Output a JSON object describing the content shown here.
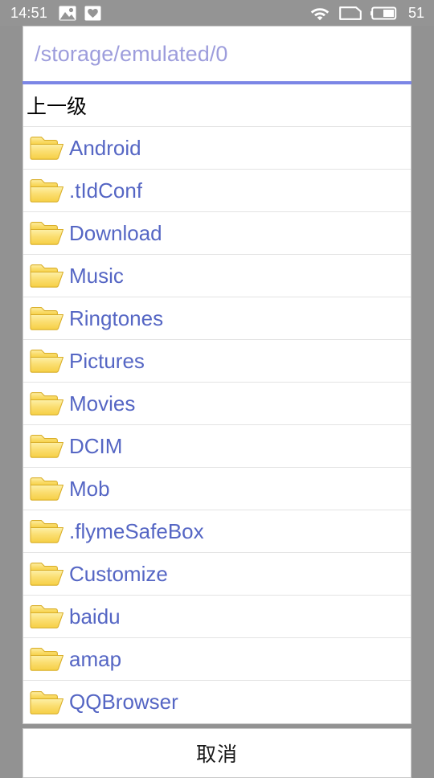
{
  "status_bar": {
    "time": "14:51",
    "battery_level": "51",
    "left_icons": [
      "image-notification-icon",
      "heart-shield-notification-icon"
    ],
    "right_icons": [
      "wifi-icon",
      "sim-card-icon",
      "battery-icon"
    ],
    "background_color": "#949494",
    "foreground_color": "#ffffff"
  },
  "dialog": {
    "path_field": {
      "value": "/storage/emulated/0",
      "placeholder": "/storage/emulated/0",
      "text_color": "#9d9ddc",
      "underline_color": "#7b86e6"
    },
    "parent_entry": {
      "label": "上一级",
      "text_color": "#000000"
    },
    "folder_text_color": "#5566c4",
    "entries": [
      {
        "name": "Android",
        "icon": "folder-icon"
      },
      {
        "name": ".tIdConf",
        "icon": "folder-icon"
      },
      {
        "name": "Download",
        "icon": "folder-icon"
      },
      {
        "name": "Music",
        "icon": "folder-icon"
      },
      {
        "name": "Ringtones",
        "icon": "folder-icon"
      },
      {
        "name": "Pictures",
        "icon": "folder-icon"
      },
      {
        "name": "Movies",
        "icon": "folder-icon"
      },
      {
        "name": "DCIM",
        "icon": "folder-icon"
      },
      {
        "name": "Mob",
        "icon": "folder-icon"
      },
      {
        "name": ".flymeSafeBox",
        "icon": "folder-icon"
      },
      {
        "name": "Customize",
        "icon": "folder-icon"
      },
      {
        "name": "baidu",
        "icon": "folder-icon"
      },
      {
        "name": "amap",
        "icon": "folder-icon"
      },
      {
        "name": "QQBrowser",
        "icon": "folder-icon"
      }
    ],
    "cancel_button": {
      "label": "取消"
    }
  },
  "page_background_color": "#929292"
}
